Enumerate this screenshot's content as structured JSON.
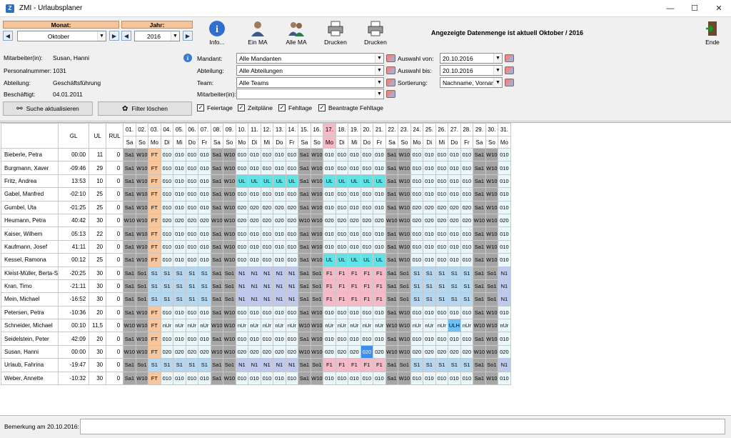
{
  "window": {
    "title": "ZMI - Urlaubsplaner",
    "min": "—",
    "max": "☐",
    "close": "✕"
  },
  "nav": {
    "month_label": "Monat:",
    "year_label": "Jahr:",
    "month_value": "Oktober",
    "year_value": "2016",
    "prev": "◀",
    "next": "▶",
    "dd": "▼"
  },
  "toolbar": {
    "info": "Info...",
    "one": "Ein MA",
    "all": "Alle MA",
    "print1": "Drucken",
    "print2": "Drucken",
    "end": "Ende"
  },
  "status_message": "Angezeigte Datenmenge ist aktuell  Oktober / 2016",
  "employee": {
    "name_label": "Mitarbeiter(in):",
    "name_value": "Susan, Hanni",
    "pnr_label": "Personalnummer:",
    "pnr_value": "1031",
    "dept_label": "Abteilung:",
    "dept_value": "Geschäftsführung",
    "since_label": "Beschäftigt:",
    "since_value": "04.01.2011"
  },
  "filters": {
    "mandant_label": "Mandant:",
    "mandant_value": "Alle Mandanten",
    "abteilung_label": "Abteilung:",
    "abteilung_value": "Alle Abteilungen",
    "team_label": "Team:",
    "team_value": "Alle Teams",
    "ma_label": "Mitarbeiter(in):",
    "ma_value": "",
    "von_label": "Auswahl von:",
    "von_value": "20.10.2016",
    "bis_label": "Auswahl bis:",
    "bis_value": "20.10.2016",
    "sort_label": "Sortierung:",
    "sort_value": "Nachname, Vorname"
  },
  "buttons": {
    "refresh": "Suche aktualisieren",
    "clear": "Filter löschen"
  },
  "checks": {
    "feiertage": "Feiertage",
    "zeitplaene": "Zeitpläne",
    "fehltage": "Fehltage",
    "beantragt": "Beantragte Fehltage",
    "mark": "✓"
  },
  "grid": {
    "col_headers": [
      "GL",
      "UL",
      "RUL"
    ],
    "days": [
      "01.",
      "02.",
      "03.",
      "04.",
      "05.",
      "06.",
      "07.",
      "08.",
      "09.",
      "10.",
      "11.",
      "12.",
      "13.",
      "14.",
      "15.",
      "16.",
      "17.",
      "18.",
      "19.",
      "20.",
      "21.",
      "22.",
      "23.",
      "24.",
      "25.",
      "26.",
      "27.",
      "28.",
      "29.",
      "30.",
      "31."
    ],
    "weekdays": [
      "Sa",
      "So",
      "Mo",
      "Di",
      "Mi",
      "Do",
      "Fr",
      "Sa",
      "So",
      "Mo",
      "Di",
      "Mi",
      "Do",
      "Fr",
      "Sa",
      "So",
      "Mo",
      "Di",
      "Mi",
      "Do",
      "Fr",
      "Sa",
      "So",
      "Mo",
      "Di",
      "Mi",
      "Do",
      "Fr",
      "Sa",
      "So",
      "Mo"
    ],
    "rows": [
      {
        "name": "Bieberle, Petra",
        "gl": "00:00",
        "ul": "11",
        "rul": "0",
        "cells": [
          "Sa1",
          "W10",
          "FT",
          "010",
          "010",
          "010",
          "010",
          "Sa1",
          "W10",
          "010",
          "010",
          "010",
          "010",
          "010",
          "Sa1",
          "W10",
          "010",
          "010",
          "010",
          "010",
          "010",
          "Sa1",
          "W10",
          "010",
          "010",
          "010",
          "010",
          "010",
          "Sa1",
          "W10",
          "010"
        ]
      },
      {
        "name": "Burgmann, Xaver",
        "gl": "-09:46",
        "ul": "29",
        "rul": "0",
        "cells": [
          "Sa1",
          "W10",
          "FT",
          "010",
          "010",
          "010",
          "010",
          "Sa1",
          "W10",
          "010",
          "010",
          "010",
          "010",
          "010",
          "Sa1",
          "W10",
          "010",
          "010",
          "010",
          "010",
          "010",
          "Sa1",
          "W10",
          "010",
          "010",
          "010",
          "010",
          "010",
          "Sa1",
          "W10",
          "010"
        ]
      },
      {
        "name": "Fritz, Andrea",
        "gl": "13:53",
        "ul": "10",
        "rul": "0",
        "cells": [
          "Sa1",
          "W10",
          "FT",
          "010",
          "010",
          "010",
          "010",
          "Sa1",
          "W10",
          "UL",
          "UL",
          "UL",
          "UL",
          "UL",
          "Sa1",
          "W10",
          "UL",
          "UL",
          "UL",
          "UL",
          "UL",
          "Sa1",
          "W10",
          "010",
          "010",
          "010",
          "010",
          "010",
          "Sa1",
          "W10",
          "010"
        ]
      },
      {
        "name": "Gabel, Manfred",
        "gl": "-02:10",
        "ul": "25",
        "rul": "0",
        "cells": [
          "Sa1",
          "W10",
          "FT",
          "010",
          "010",
          "010",
          "010",
          "Sa1",
          "W10",
          "010",
          "010",
          "010",
          "010",
          "010",
          "Sa1",
          "W10",
          "010",
          "010",
          "010",
          "010",
          "010",
          "Sa1",
          "W10",
          "010",
          "010",
          "010",
          "010",
          "010",
          "Sa1",
          "W10",
          "010"
        ]
      },
      {
        "name": "Gumbel, Uta",
        "gl": "-01:25",
        "ul": "25",
        "rul": "0",
        "cells": [
          "Sa1",
          "W10",
          "FT",
          "010",
          "010",
          "010",
          "010",
          "Sa1",
          "W10",
          "020",
          "020",
          "020",
          "020",
          "020",
          "Sa1",
          "W10",
          "010",
          "010",
          "010",
          "010",
          "010",
          "Sa1",
          "W10",
          "020",
          "020",
          "020",
          "020",
          "020",
          "Sa1",
          "W10",
          "010"
        ]
      },
      {
        "name": "Heumann, Petra",
        "gl": "40:42",
        "ul": "30",
        "rul": "0",
        "cells": [
          "W10",
          "W10",
          "FT",
          "020",
          "020",
          "020",
          "020",
          "W10",
          "W10",
          "020",
          "020",
          "020",
          "020",
          "020",
          "W10",
          "W10",
          "020",
          "020",
          "020",
          "020",
          "020",
          "W10",
          "W10",
          "020",
          "020",
          "020",
          "020",
          "020",
          "W10",
          "W10",
          "020"
        ]
      },
      {
        "name": "Kaiser, Wilhem",
        "gl": "05:13",
        "ul": "22",
        "rul": "0",
        "cells": [
          "Sa1",
          "W10",
          "FT",
          "010",
          "010",
          "010",
          "010",
          "Sa1",
          "W10",
          "010",
          "010",
          "010",
          "010",
          "010",
          "Sa1",
          "W10",
          "010",
          "010",
          "010",
          "010",
          "010",
          "Sa1",
          "W10",
          "010",
          "010",
          "010",
          "010",
          "010",
          "Sa1",
          "W10",
          "010"
        ]
      },
      {
        "name": "Kaufmann, Josef",
        "gl": "41:11",
        "ul": "20",
        "rul": "0",
        "cells": [
          "Sa1",
          "W10",
          "FT",
          "010",
          "010",
          "010",
          "010",
          "Sa1",
          "W10",
          "010",
          "010",
          "010",
          "010",
          "010",
          "Sa1",
          "W10",
          "010",
          "010",
          "010",
          "010",
          "010",
          "Sa1",
          "W10",
          "010",
          "010",
          "010",
          "010",
          "010",
          "Sa1",
          "W10",
          "010"
        ]
      },
      {
        "name": "Kessel, Ramona",
        "gl": "00:12",
        "ul": "25",
        "rul": "0",
        "cells": [
          "Sa1",
          "W10",
          "FT",
          "010",
          "010",
          "010",
          "010",
          "Sa1",
          "W10",
          "010",
          "010",
          "010",
          "010",
          "010",
          "Sa1",
          "W10",
          "UL",
          "UL",
          "UL",
          "UL",
          "UL",
          "Sa1",
          "W10",
          "010",
          "010",
          "010",
          "010",
          "010",
          "Sa1",
          "W10",
          "010"
        ]
      },
      {
        "name": "Kleist-Müller, Berta-S",
        "gl": "-20:25",
        "ul": "30",
        "rul": "0",
        "cells": [
          "Sa1",
          "So1",
          "S1",
          "S1",
          "S1",
          "S1",
          "S1",
          "Sa1",
          "So1",
          "N1",
          "N1",
          "N1",
          "N1",
          "N1",
          "Sa1",
          "So1",
          "F1",
          "F1",
          "F1",
          "F1",
          "F1",
          "Sa1",
          "So1",
          "S1",
          "S1",
          "S1",
          "S1",
          "S1",
          "Sa1",
          "So1",
          "N1"
        ]
      },
      {
        "name": "Kran, Timo",
        "gl": "-21:11",
        "ul": "30",
        "rul": "0",
        "cells": [
          "Sa1",
          "So1",
          "S1",
          "S1",
          "S1",
          "S1",
          "S1",
          "Sa1",
          "So1",
          "N1",
          "N1",
          "N1",
          "N1",
          "N1",
          "Sa1",
          "So1",
          "F1",
          "F1",
          "F1",
          "F1",
          "F1",
          "Sa1",
          "So1",
          "S1",
          "S1",
          "S1",
          "S1",
          "S1",
          "Sa1",
          "So1",
          "N1"
        ]
      },
      {
        "name": "Mein, Michael",
        "gl": "-16:52",
        "ul": "30",
        "rul": "0",
        "cells": [
          "Sa1",
          "So1",
          "S1",
          "S1",
          "S1",
          "S1",
          "S1",
          "Sa1",
          "So1",
          "N1",
          "N1",
          "N1",
          "N1",
          "N1",
          "Sa1",
          "So1",
          "F1",
          "F1",
          "F1",
          "F1",
          "F1",
          "Sa1",
          "So1",
          "S1",
          "S1",
          "S1",
          "S1",
          "S1",
          "Sa1",
          "So1",
          "N1"
        ]
      },
      {
        "name": "Petersen, Petra",
        "gl": "-10:36",
        "ul": "20",
        "rul": "0",
        "cells": [
          "Sa1",
          "W10",
          "FT",
          "010",
          "010",
          "010",
          "010",
          "Sa1",
          "W10",
          "010",
          "010",
          "010",
          "010",
          "010",
          "Sa1",
          "W10",
          "010",
          "010",
          "010",
          "010",
          "010",
          "Sa1",
          "W10",
          "010",
          "010",
          "010",
          "010",
          "010",
          "Sa1",
          "W10",
          "010"
        ]
      },
      {
        "name": "Schneider, Michael",
        "gl": "00:10",
        "ul": "11,5",
        "rul": "0",
        "cells": [
          "W10",
          "W10",
          "FT",
          "nUr",
          "nUr",
          "nUr",
          "nUr",
          "W10",
          "W10",
          "nUr",
          "nUr",
          "nUr",
          "nUr",
          "nUr",
          "W10",
          "W10",
          "nUr",
          "nUr",
          "nUr",
          "nUr",
          "nUr",
          "W10",
          "W10",
          "nUr",
          "nUr",
          "nUr",
          "ULH",
          "nUr",
          "W10",
          "W10",
          "nUr"
        ]
      },
      {
        "name": "Seidelstein, Peter",
        "gl": "42:09",
        "ul": "20",
        "rul": "0",
        "cells": [
          "Sa1",
          "W10",
          "FT",
          "010",
          "010",
          "010",
          "010",
          "Sa1",
          "W10",
          "010",
          "010",
          "010",
          "010",
          "010",
          "Sa1",
          "W10",
          "010",
          "010",
          "010",
          "010",
          "010",
          "Sa1",
          "W10",
          "010",
          "010",
          "010",
          "010",
          "010",
          "Sa1",
          "W10",
          "010"
        ]
      },
      {
        "name": "Susan, Hanni",
        "gl": "00:00",
        "ul": "30",
        "rul": "0",
        "cells": [
          "W10",
          "W10",
          "FT",
          "020",
          "020",
          "020",
          "020",
          "W10",
          "W10",
          "020",
          "020",
          "020",
          "020",
          "020",
          "W10",
          "W10",
          "020",
          "020",
          "020",
          "020",
          "020",
          "W10",
          "W10",
          "020",
          "020",
          "020",
          "020",
          "020",
          "W10",
          "W10",
          "020"
        ]
      },
      {
        "name": "Urlaub, Fahrina",
        "gl": "-19:47",
        "ul": "30",
        "rul": "0",
        "cells": [
          "Sa1",
          "So1",
          "S1",
          "S1",
          "S1",
          "S1",
          "S1",
          "Sa1",
          "So1",
          "N1",
          "N1",
          "N1",
          "N1",
          "N1",
          "Sa1",
          "So1",
          "F1",
          "F1",
          "F1",
          "F1",
          "F1",
          "Sa1",
          "So1",
          "S1",
          "S1",
          "S1",
          "S1",
          "S1",
          "Sa1",
          "So1",
          "N1"
        ]
      },
      {
        "name": "Weber, Annette",
        "gl": "-10:32",
        "ul": "30",
        "rul": "0",
        "cells": [
          "Sa1",
          "W10",
          "FT",
          "010",
          "010",
          "010",
          "010",
          "Sa1",
          "W10",
          "010",
          "010",
          "010",
          "010",
          "010",
          "Sa1",
          "W10",
          "010",
          "010",
          "010",
          "010",
          "010",
          "Sa1",
          "W10",
          "010",
          "010",
          "010",
          "010",
          "010",
          "Sa1",
          "W10",
          "010"
        ]
      }
    ]
  },
  "remark": {
    "label": "Bemerkung am  20.10.2016:",
    "value": ""
  }
}
